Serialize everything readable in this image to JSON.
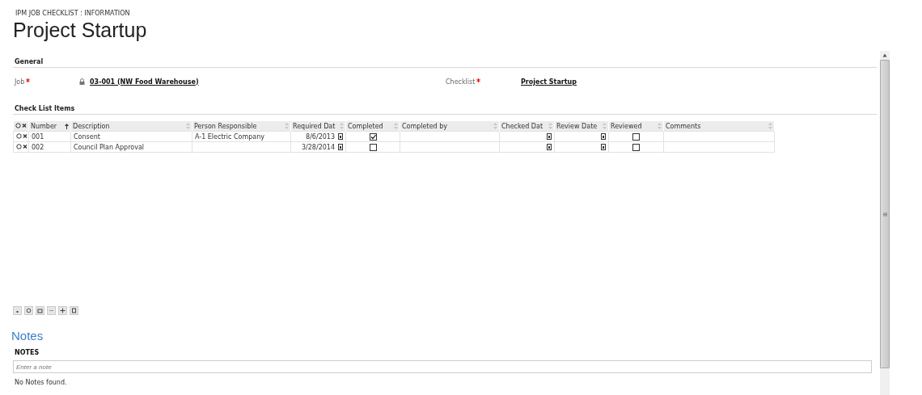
{
  "breadcrumb": "IPM JOB CHECKLIST : INFORMATION",
  "title": "Project Startup",
  "general": {
    "heading": "General",
    "fields": [
      {
        "label": "Job",
        "required": true,
        "locked": true,
        "value": "03-001 (NW Food Warehouse)"
      },
      {
        "label": "Checklist",
        "required": true,
        "locked": false,
        "value": "Project Startup"
      }
    ]
  },
  "checklist": {
    "heading": "Check List Items",
    "columns": [
      {
        "label": "Number",
        "sorted": true
      },
      {
        "label": "Description",
        "sorted": false
      },
      {
        "label": "Person Responsible",
        "sorted": false
      },
      {
        "label": "Required Dat",
        "sorted": false
      },
      {
        "label": "Completed",
        "sorted": false
      },
      {
        "label": "Completed by",
        "sorted": false
      },
      {
        "label": "Checked Dat",
        "sorted": false
      },
      {
        "label": "Review Date",
        "sorted": false
      },
      {
        "label": "Reviewed",
        "sorted": false
      },
      {
        "label": "Comments",
        "sorted": false
      }
    ],
    "rows": [
      {
        "number": "001",
        "description": "Consent",
        "person": "A-1 Electric Company",
        "required_date": "8/6/2013",
        "completed": true,
        "completed_by": "",
        "checked_date": "",
        "review_date": "",
        "reviewed": false,
        "comments": ""
      },
      {
        "number": "002",
        "description": "Council Plan Approval",
        "person": "",
        "required_date": "3/28/2014",
        "completed": false,
        "completed_by": "",
        "checked_date": "",
        "review_date": "",
        "reviewed": false,
        "comments": ""
      }
    ]
  },
  "notes": {
    "heading": "Notes",
    "label": "NOTES",
    "placeholder": "Enter a note",
    "empty_text": "No Notes found."
  }
}
